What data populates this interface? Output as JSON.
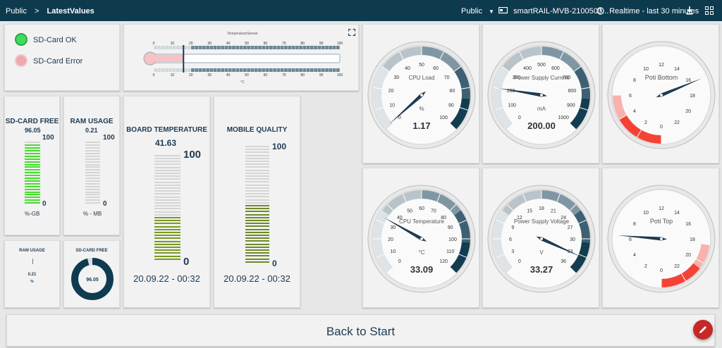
{
  "header": {
    "breadcrumb_root": "Public",
    "breadcrumb_sep": ">",
    "breadcrumb_page": "LatestValues",
    "workspace": "Public",
    "device": "smartRAIL-MVB-2100500...",
    "time_range": "Realtime - last 30 minutes"
  },
  "status": {
    "ok_label": "SD-Card OK",
    "error_label": "SD-Card Error",
    "ok_color": "#3ddc5a",
    "error_color": "#f0a8ae"
  },
  "thermometer": {
    "label": "TemperatureSensor",
    "unit": "°C",
    "ticks": [
      "0",
      "10",
      "20",
      "30",
      "40",
      "50",
      "60",
      "70",
      "80",
      "90",
      "100"
    ],
    "value": 16
  },
  "sdcard_free": {
    "title": "SD-CARD FREE",
    "value": "96.05",
    "max": "100",
    "min": "0",
    "unit": "%-GB",
    "fraction": 0.9605,
    "color": "#44dd2a"
  },
  "ram_usage": {
    "title": "RAM USAGE",
    "value": "0.21",
    "max": "100",
    "min": "0",
    "unit": "% - MB",
    "fraction": 0.0021
  },
  "board_temp": {
    "title": "BOARD TEMPERATURE",
    "value": "41.63",
    "max": "100",
    "min": "0",
    "timestamp": "20.09.22 - 00:32",
    "fraction": 0.4163,
    "color": "#7a9a22"
  },
  "mobile_quality": {
    "title": "MOBILE QUALITY",
    "max": "100",
    "min": "0",
    "timestamp": "20.09.22 - 00:32",
    "fraction": 0.5,
    "color": "#6f8a28"
  },
  "ram_small": {
    "title": "RAM USAGE",
    "value": "0.21",
    "unit": "%"
  },
  "sd_donut": {
    "title": "SD-CARD FREE",
    "value": "96.05",
    "fraction": 0.9605
  },
  "gauges": {
    "cpu_load": {
      "label": "CPU Load",
      "unit": "%",
      "ticks": [
        "0",
        "10",
        "20",
        "30",
        "40",
        "50",
        "60",
        "70",
        "80",
        "90",
        "100"
      ],
      "min": 0,
      "max": 100,
      "value": 1.17,
      "display": "1.17"
    },
    "power_current": {
      "label": "Power Supply Current",
      "unit": "mA",
      "ticks": [
        "0",
        "100",
        "200",
        "300",
        "400",
        "500",
        "600",
        "700",
        "800",
        "900",
        "1000"
      ],
      "min": 0,
      "max": 1000,
      "value": 200,
      "display": "200.00"
    },
    "poti_bottom": {
      "label": "Poti Bottom",
      "ticks": [
        "0",
        "2",
        "4",
        "6",
        "8",
        "10",
        "12",
        "14",
        "16",
        "18",
        "20",
        "22"
      ],
      "min": 0,
      "max": 24,
      "value": 16.5
    },
    "cpu_temp": {
      "label": "CPU Temperature",
      "unit": "°C",
      "ticks": [
        "0",
        "10",
        "20",
        "30",
        "40",
        "50",
        "60",
        "70",
        "80",
        "90",
        "100",
        "110",
        "120"
      ],
      "min": 0,
      "max": 120,
      "value": 33.09,
      "display": "33.09"
    },
    "power_voltage": {
      "label": "Power Supply Voltage",
      "unit": "V",
      "ticks": [
        "0",
        "3",
        "6",
        "9",
        "12",
        "15",
        "18",
        "21",
        "24",
        "27",
        "30",
        "33",
        "36"
      ],
      "min": 0,
      "max": 36,
      "value": 33.27,
      "display": "33.27"
    },
    "poti_top": {
      "label": "Poti Top",
      "ticks": [
        "0",
        "2",
        "4",
        "6",
        "8",
        "10",
        "12",
        "14",
        "16",
        "18",
        "20",
        "22"
      ],
      "min": 0,
      "max": 24,
      "value": 6.3
    }
  },
  "footer": {
    "back_label": "Back to Start"
  }
}
